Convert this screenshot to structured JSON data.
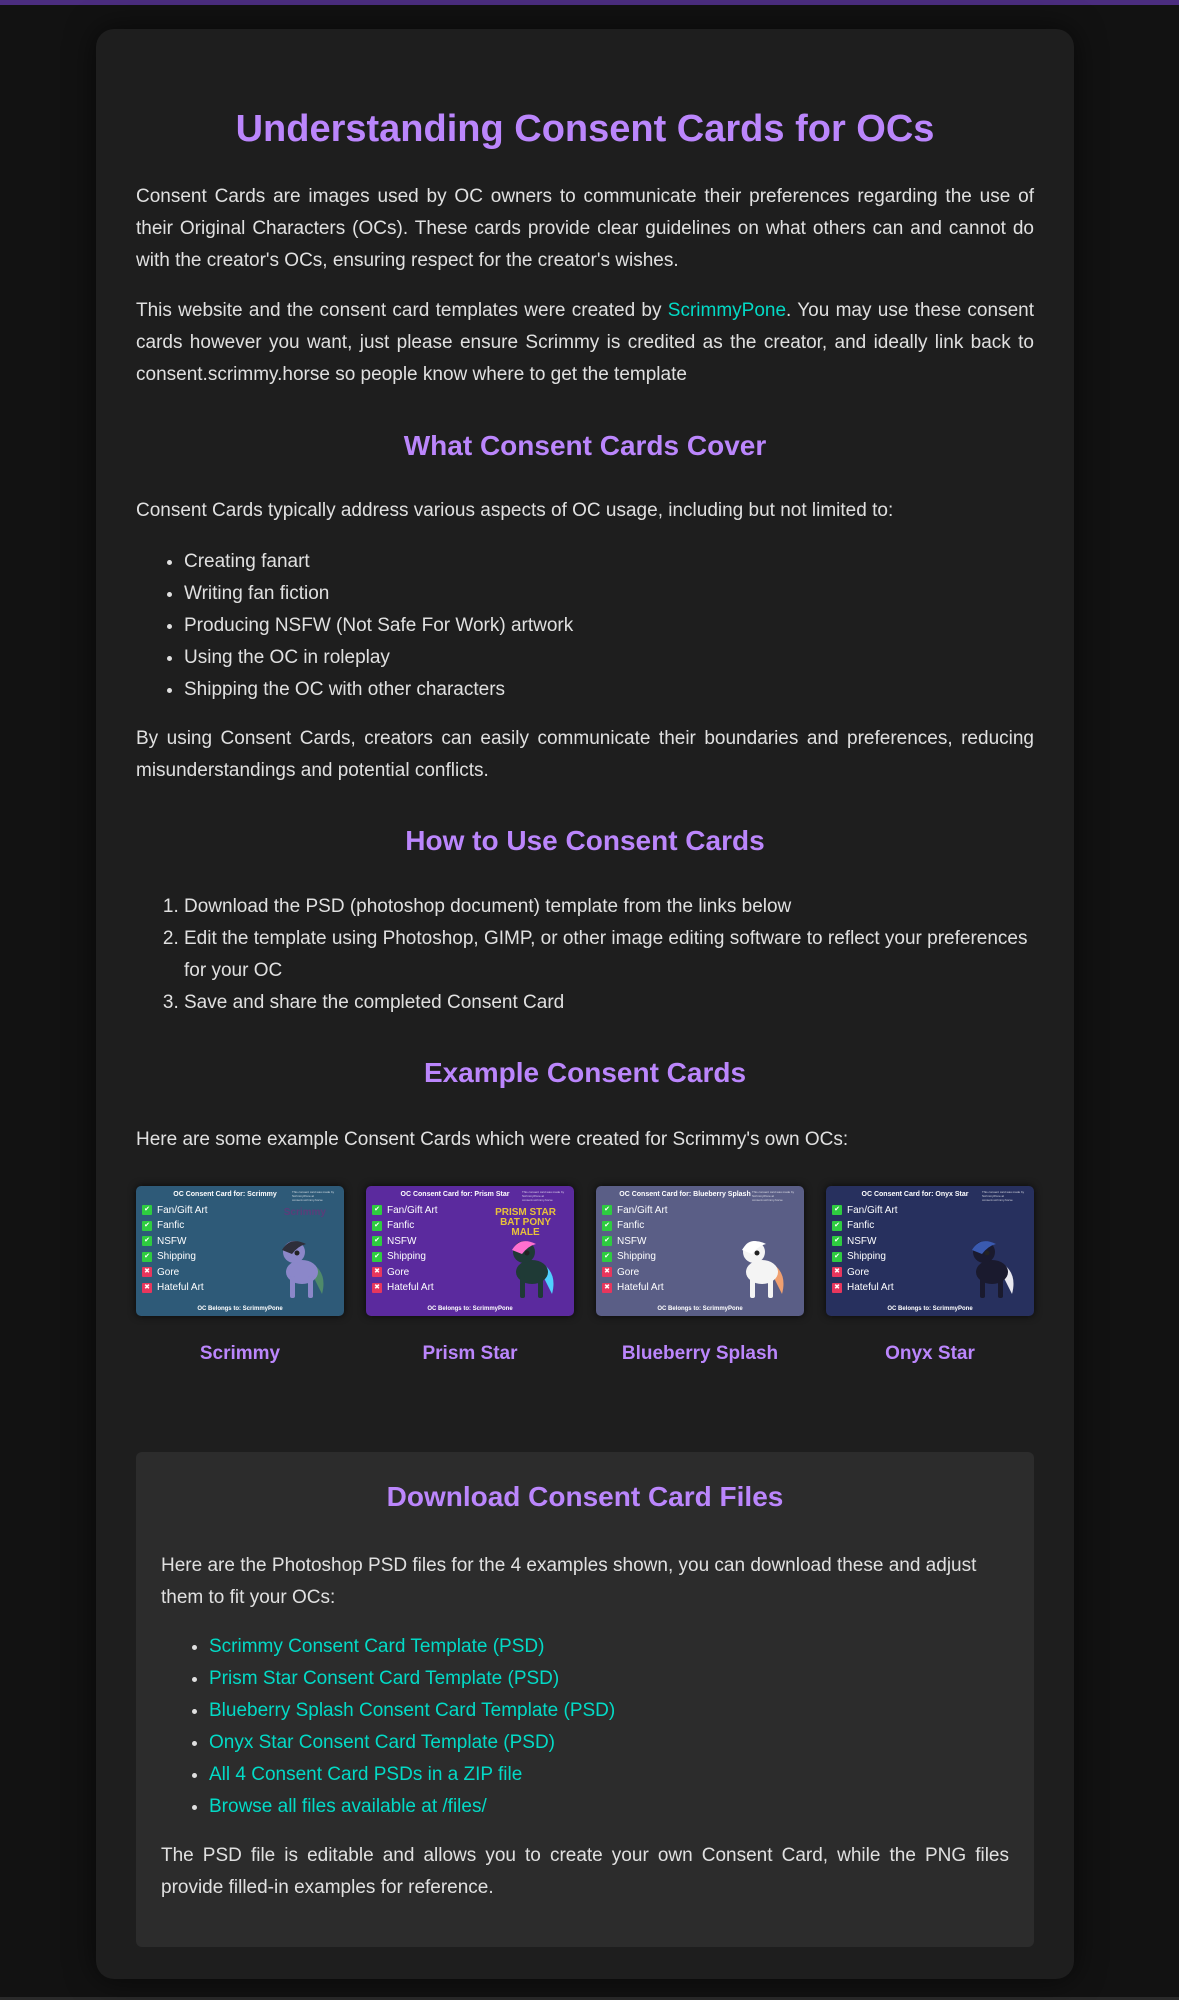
{
  "page": {
    "title": "Understanding Consent Cards for OCs",
    "intro": "Consent Cards are images used by OC owners to communicate their preferences regarding the use of their Original Characters (OCs). These cards provide clear guidelines on what others can and cannot do with the creator's OCs, ensuring respect for the creator's wishes.",
    "credit": {
      "before": "This website and the consent card templates were created by ",
      "link": "ScrimmyPone",
      "after": ". You may use these consent cards however you want, just please ensure Scrimmy is credited as the creator, and ideally link back to consent.scrimmy.horse so people know where to get the template"
    }
  },
  "cover": {
    "heading": "What Consent Cards Cover",
    "intro": "Consent Cards typically address various aspects of OC usage, including but not limited to:",
    "items": [
      "Creating fanart",
      "Writing fan fiction",
      "Producing NSFW (Not Safe For Work) artwork",
      "Using the OC in roleplay",
      "Shipping the OC with other characters"
    ],
    "outro": "By using Consent Cards, creators can easily communicate their boundaries and preferences, reducing misunderstandings and potential conflicts."
  },
  "how": {
    "heading": "How to Use Consent Cards",
    "steps": [
      "Download the PSD (photoshop document) template from the links below",
      "Edit the template using Photoshop, GIMP, or other image editing software to reflect your preferences for your OC",
      "Save and share the completed Consent Card"
    ]
  },
  "examples": {
    "heading": "Example Consent Cards",
    "intro": "Here are some example Consent Cards which were created for Scrimmy's own OCs:",
    "card_footer": "OC Belongs to: ScrimmyPone",
    "card_note": "This consent card was made by ScrimmyPone at consent.scrimmy.horse",
    "row_labels": [
      "Fan/Gift Art",
      "Fanfic",
      "NSFW",
      "Shipping",
      "Gore",
      "Hateful Art"
    ],
    "row_allowed": [
      true,
      true,
      true,
      true,
      false,
      false
    ],
    "check_icon": "✔",
    "cross_icon": "✖",
    "cards": [
      {
        "name": "Scrimmy",
        "title": "OC Consent Card for: Scrimmy",
        "bg": "#2e5a78",
        "logo": "Scrimmy",
        "logo_color": "#5a3d7a",
        "pony_body": "#8b87c9",
        "pony_mane": "#2e2e3a",
        "pony_tail": "#4f8a6a"
      },
      {
        "name": "Prism Star",
        "title": "OC Consent Card for: Prism Star",
        "bg": "#5b2a9e",
        "logo": "PRISM STAR\nBAT PONY\nMALE",
        "logo_color": "#e8c23a",
        "pony_body": "#1f3a36",
        "pony_mane": "#ff6fd0",
        "pony_tail": "#4fd0ff"
      },
      {
        "name": "Blueberry Splash",
        "title": "OC Consent Card for: Blueberry Splash",
        "bg": "#5a5e86",
        "logo": "",
        "logo_color": "#ffffff",
        "pony_body": "#f4f4f4",
        "pony_mane": "#ffffff",
        "pony_tail": "#f0a070"
      },
      {
        "name": "Onyx Star",
        "title": "OC Consent Card for: Onyx Star",
        "bg": "#27305e",
        "logo": "",
        "logo_color": "#ffffff",
        "pony_body": "#1a1a2e",
        "pony_mane": "#3a5ab0",
        "pony_tail": "#e8e8f0"
      }
    ]
  },
  "downloads": {
    "heading": "Download Consent Card Files",
    "intro": "Here are the Photoshop PSD files for the 4 examples shown, you can download these and adjust them to fit your OCs:",
    "links": [
      "Scrimmy Consent Card Template (PSD)",
      "Prism Star Consent Card Template (PSD)",
      "Blueberry Splash Consent Card Template (PSD)",
      "Onyx Star Consent Card Template (PSD)",
      "All 4 Consent Card PSDs in a ZIP file",
      "Browse all files available at /files/"
    ],
    "note": "The PSD file is editable and allows you to create your own Consent Card, while the PNG files provide filled-in examples for reference."
  },
  "colors": {
    "accent": "#bb86fc",
    "link": "#03dac6",
    "background": "#121212",
    "surface": "#1e1e1e",
    "surface_alt": "#2c2c2c",
    "top_bar": "#4b2d7f"
  }
}
